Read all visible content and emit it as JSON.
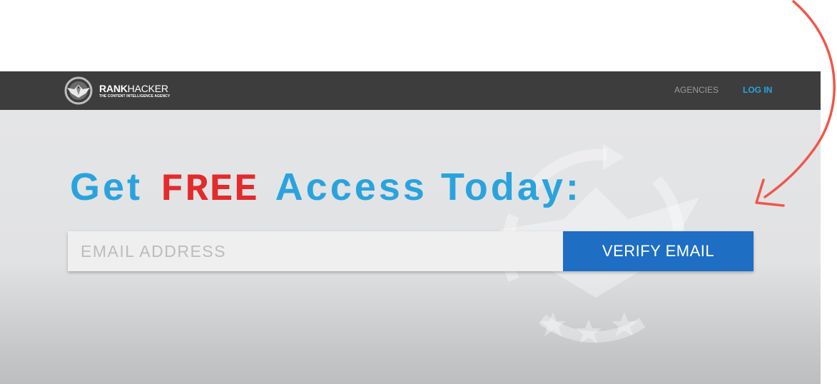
{
  "header": {
    "logo": {
      "name_bold": "RANK",
      "name_regular": "HACKER",
      "tagline": "THE CONTENT INTELLIGENCE AGENCY",
      "icon": "eagle-shield-icon"
    },
    "nav": [
      {
        "label": "AGENCIES",
        "color": "#9a9a9a"
      },
      {
        "label": "LOG IN",
        "color": "#2aa3dd"
      }
    ]
  },
  "hero": {
    "headline_start": "Get",
    "headline_highlight": "FREE",
    "headline_end": "Access Today:",
    "headline_color": "#2aa3dd",
    "highlight_color": "#e32b2b"
  },
  "signup": {
    "email_placeholder": "EMAIL ADDRESS",
    "email_value": "",
    "button_label": "VERIFY EMAIL",
    "button_color": "#1e6ec4"
  },
  "annotation": {
    "arrow_color": "#f0574a",
    "icon": "curved-arrow-icon"
  },
  "colors": {
    "navbar": "#3d3d3d",
    "hero_background": "#e2e3e5"
  }
}
